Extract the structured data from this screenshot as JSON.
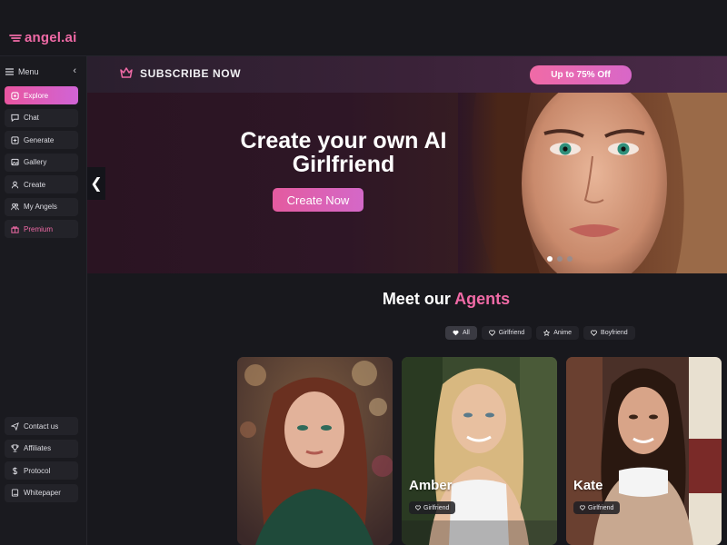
{
  "app": {
    "logo_text": "angel.ai",
    "brand_color": "#f06aa6"
  },
  "sidebar": {
    "menu_label": "Menu",
    "items": [
      {
        "label": "Explore",
        "icon": "explore-icon",
        "active": true
      },
      {
        "label": "Chat",
        "icon": "chat-icon"
      },
      {
        "label": "Generate",
        "icon": "generate-icon"
      },
      {
        "label": "Gallery",
        "icon": "gallery-icon"
      },
      {
        "label": "Create",
        "icon": "create-icon"
      },
      {
        "label": "My Angels",
        "icon": "users-icon"
      },
      {
        "label": "Premium",
        "icon": "gift-icon"
      }
    ],
    "bottom_items": [
      {
        "label": "Contact us",
        "icon": "send-icon"
      },
      {
        "label": "Affiliates",
        "icon": "trophy-icon"
      },
      {
        "label": "Protocol",
        "icon": "dollar-icon"
      },
      {
        "label": "Whitepaper",
        "icon": "book-icon"
      }
    ]
  },
  "subscribe": {
    "label": "SUBSCRIBE NOW",
    "offer": "Up to 75% Off"
  },
  "hero": {
    "title_line1": "Create your own AI",
    "title_line2": "Girlfriend",
    "cta": "Create Now",
    "slides": 3,
    "active_slide": 1
  },
  "agents": {
    "title_main": "Meet our",
    "title_accent": "Agents",
    "filters": [
      {
        "label": "All",
        "active": true
      },
      {
        "label": "Girlfriend"
      },
      {
        "label": "Anime"
      },
      {
        "label": "Boyfriend"
      }
    ],
    "cards": [
      {
        "name": "",
        "tag": ""
      },
      {
        "name": "Amber",
        "tag": "Girlfriend"
      },
      {
        "name": "Kate",
        "tag": "Girlfriend"
      }
    ]
  }
}
